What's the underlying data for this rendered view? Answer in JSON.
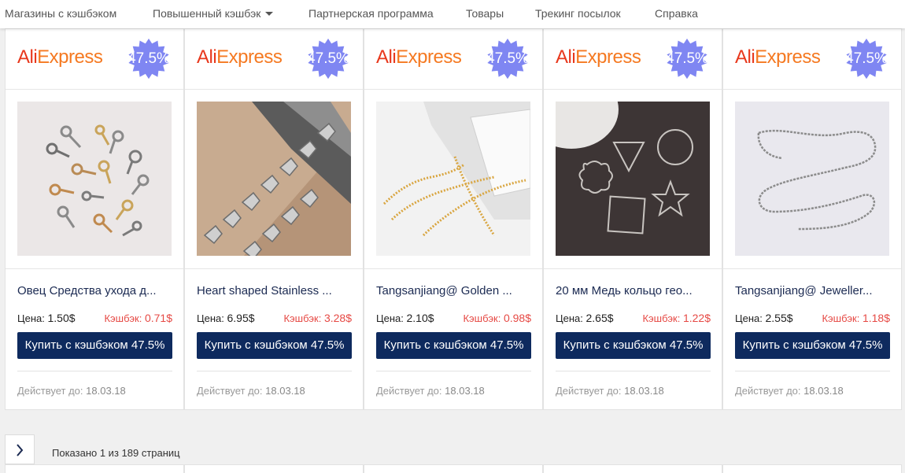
{
  "nav": {
    "items": [
      "Магазины с кэшбэком",
      "Повышенный кэшбэк",
      "Партнерская программа",
      "Товары",
      "Трекинг посылок",
      "Справка"
    ]
  },
  "cards": [
    {
      "store": "AliExpress",
      "badge": "47.5%",
      "title": "Овец Средства ухода д...",
      "price_label": "Цена:",
      "price": "1.50$",
      "cashback_label": "Кэшбэк:",
      "cashback": "0.71$",
      "buy_label": "Купить с кэшбэком 47.5%",
      "valid_label": "Действует до:",
      "valid_date": "18.03.18",
      "image": "eye-pins"
    },
    {
      "store": "AliExpress",
      "badge": "47.5%",
      "title": "Heart shaped Stainless ...",
      "price_label": "Цена:",
      "price": "6.95$",
      "cashback_label": "Кэшбэк:",
      "cashback": "3.28$",
      "buy_label": "Купить с кэшбэком 47.5%",
      "valid_label": "Действует до:",
      "valid_date": "18.03.18",
      "image": "heart-chain"
    },
    {
      "store": "AliExpress",
      "badge": "47.5%",
      "title": "Tangsanjiang@ Golden ...",
      "price_label": "Цена:",
      "price": "2.10$",
      "cashback_label": "Кэшбэк:",
      "cashback": "0.98$",
      "buy_label": "Купить с кэшбэком 47.5%",
      "valid_label": "Действует до:",
      "valid_date": "18.03.18",
      "image": "gold-chain"
    },
    {
      "store": "AliExpress",
      "badge": "47.5%",
      "title": "20 мм Медь кольцо гео...",
      "price_label": "Цена:",
      "price": "2.65$",
      "cashback_label": "Кэшбэк:",
      "cashback": "1.22$",
      "buy_label": "Купить с кэшбэком 47.5%",
      "valid_label": "Действует до:",
      "valid_date": "18.03.18",
      "image": "geo-rings"
    },
    {
      "store": "AliExpress",
      "badge": "47.5%",
      "title": "Tangsanjiang@ Jeweller...",
      "price_label": "Цена:",
      "price": "2.55$",
      "cashback_label": "Кэшбэк:",
      "cashback": "1.18$",
      "buy_label": "Купить с кэшбэком 47.5%",
      "valid_label": "Действует до:",
      "valid_date": "18.03.18",
      "image": "silver-chain"
    }
  ],
  "pager": {
    "next_icon": "chevron-right-icon",
    "info": "Показано 1 из 189 страниц"
  },
  "colors": {
    "button_bg": "#0e2a5e",
    "cashback": "#e64a45",
    "badge": "#7f86f2",
    "brand": "#e8381d"
  }
}
